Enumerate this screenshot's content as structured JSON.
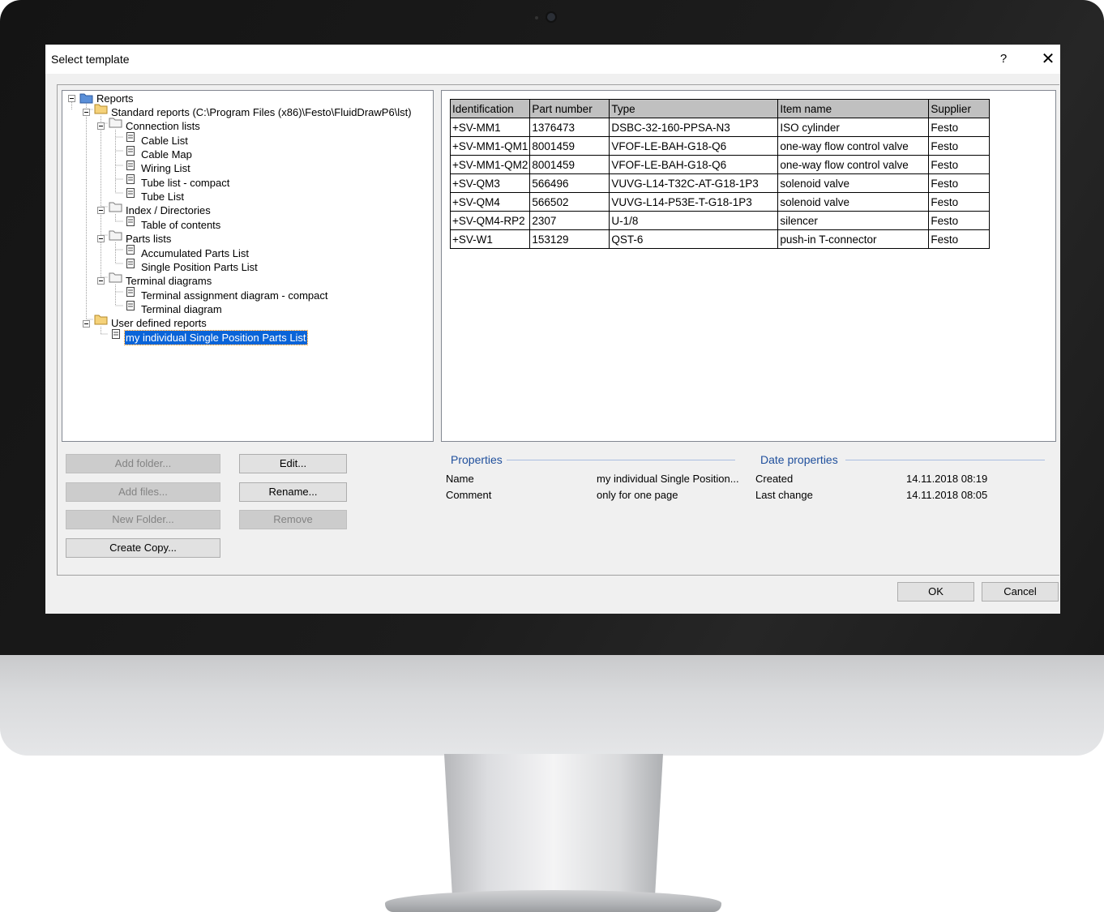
{
  "window": {
    "title": "Select template",
    "help_label": "?",
    "close_label": "✕"
  },
  "tree": {
    "nodes": [
      {
        "label": "Reports"
      },
      {
        "label": "Standard reports (C:\\Program Files (x86)\\Festo\\FluidDrawP6\\lst)"
      },
      {
        "label": "Connection lists"
      },
      {
        "label": "Cable List"
      },
      {
        "label": "Cable Map"
      },
      {
        "label": "Wiring List"
      },
      {
        "label": "Tube list - compact"
      },
      {
        "label": "Tube List"
      },
      {
        "label": "Index / Directories"
      },
      {
        "label": "Table of contents"
      },
      {
        "label": "Parts lists"
      },
      {
        "label": "Accumulated Parts List"
      },
      {
        "label": "Single Position Parts List"
      },
      {
        "label": "Terminal diagrams"
      },
      {
        "label": "Terminal assignment diagram - compact"
      },
      {
        "label": "Terminal diagram"
      },
      {
        "label": "User defined reports"
      },
      {
        "label": "my individual Single Position Parts List"
      }
    ]
  },
  "preview": {
    "headers": [
      "Identification",
      "Part number",
      "Type",
      "Item name",
      "Supplier"
    ],
    "rows": [
      [
        "+SV-MM1",
        "1376473",
        "DSBC-32-160-PPSA-N3",
        "ISO cylinder",
        "Festo"
      ],
      [
        "+SV-MM1-QM1",
        "8001459",
        "VFOF-LE-BAH-G18-Q6",
        "one-way flow control valve",
        "Festo"
      ],
      [
        "+SV-MM1-QM2",
        "8001459",
        "VFOF-LE-BAH-G18-Q6",
        "one-way flow control valve",
        "Festo"
      ],
      [
        "+SV-QM3",
        "566496",
        "VUVG-L14-T32C-AT-G18-1P3",
        "solenoid valve",
        "Festo"
      ],
      [
        "+SV-QM4",
        "566502",
        "VUVG-L14-P53E-T-G18-1P3",
        "solenoid valve",
        "Festo"
      ],
      [
        "+SV-QM4-RP2",
        "2307",
        "U-1/8",
        "silencer",
        "Festo"
      ],
      [
        "+SV-W1",
        "153129",
        "QST-6",
        "push-in T-connector",
        "Festo"
      ]
    ]
  },
  "buttons": {
    "add_folder": "Add folder...",
    "add_files": "Add files...",
    "new_folder": "New Folder...",
    "create_copy": "Create Copy...",
    "edit": "Edit...",
    "rename": "Rename...",
    "remove": "Remove",
    "ok": "OK",
    "cancel": "Cancel"
  },
  "properties": {
    "title": "Properties",
    "name_label": "Name",
    "name_value": "my individual Single Position...",
    "comment_label": "Comment",
    "comment_value": "only for one page"
  },
  "date_properties": {
    "title": "Date properties",
    "created_label": "Created",
    "created_value": "14.11.2018 08:19",
    "last_change_label": "Last change",
    "last_change_value": "14.11.2018 08:05"
  }
}
